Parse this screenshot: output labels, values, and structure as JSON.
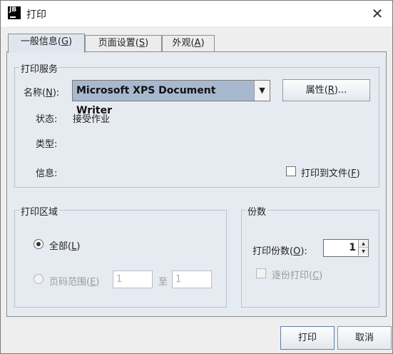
{
  "window": {
    "icon_text": "JB",
    "title": "打印",
    "close_glyph": "✕"
  },
  "tabs": [
    {
      "label": "一般信息(",
      "mnemonic": "G",
      "end": ")"
    },
    {
      "label": "页面设置(",
      "mnemonic": "S",
      "end": ")"
    },
    {
      "label": "外观(",
      "mnemonic": "A",
      "end": ")"
    }
  ],
  "print_service": {
    "title": "打印服务",
    "name_label": "名称(",
    "name_mnemonic": "N",
    "name_end": "):",
    "printer": "Microsoft XPS Document Writer",
    "dropdown_icon": "▼",
    "properties_button": {
      "label": "属性(",
      "mnemonic": "R",
      "end": ")..."
    },
    "status_label": "状态:",
    "status_value": "接受作业",
    "type_label": "类型:",
    "type_value": "",
    "info_label": "信息:",
    "info_value": "",
    "print_to_file": {
      "label": "打印到文件(",
      "mnemonic": "F",
      "end": ")",
      "checked": false
    }
  },
  "print_range": {
    "title": "打印区域",
    "all": {
      "label": "全部(",
      "mnemonic": "L",
      "end": ")",
      "selected": true
    },
    "pages": {
      "label": "页码范围(",
      "mnemonic": "E",
      "end": ")",
      "selected": false
    },
    "from_value": "1",
    "to_label": "至",
    "to_value": "1"
  },
  "copies": {
    "title": "份数",
    "count_label": "打印份数(",
    "count_mnemonic": "O",
    "count_end": "):",
    "count_value": "1",
    "collate": {
      "label": "逐份打印(",
      "mnemonic": "C",
      "end": ")",
      "checked": false
    }
  },
  "footer": {
    "print_button": "打印",
    "cancel_button": "取消"
  }
}
